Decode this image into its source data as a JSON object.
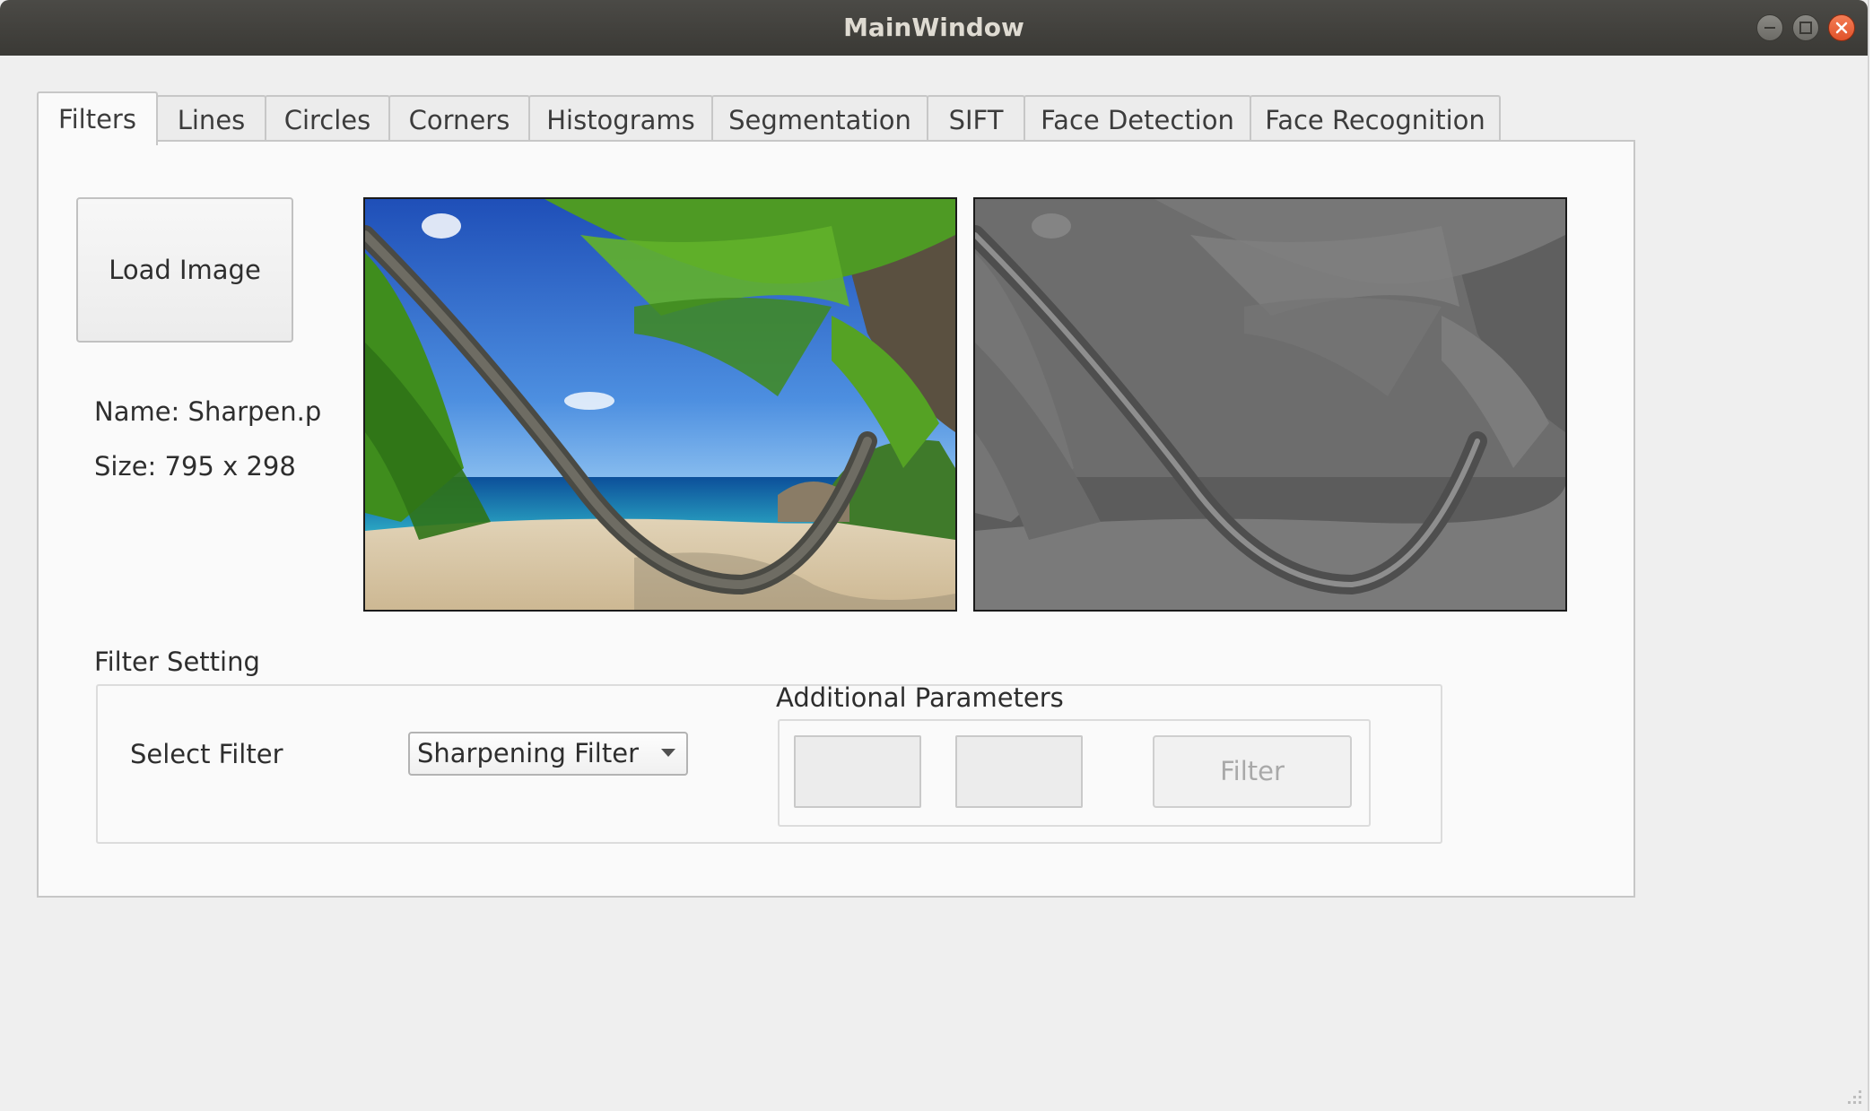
{
  "window": {
    "title": "MainWindow"
  },
  "tabs": [
    {
      "label": "Filters",
      "active": true
    },
    {
      "label": "Lines",
      "active": false
    },
    {
      "label": "Circles",
      "active": false
    },
    {
      "label": "Corners",
      "active": false
    },
    {
      "label": "Histograms",
      "active": false
    },
    {
      "label": "Segmentation",
      "active": false
    },
    {
      "label": "SIFT",
      "active": false
    },
    {
      "label": "Face Detection",
      "active": false
    },
    {
      "label": "Face Recognition",
      "active": false
    }
  ],
  "filters_tab": {
    "load_button_label": "Load Image",
    "image_name": "Name:  Sharpen.p",
    "image_size": "Size: 795 x 298",
    "filter_setting_title": "Filter Setting",
    "select_filter_label": "Select Filter",
    "selected_filter": "Sharpening Filter",
    "additional_parameters_title": "Additional Parameters",
    "param1_value": "",
    "param2_value": "",
    "filter_button_label": "Filter",
    "filter_button_enabled": false
  },
  "colors": {
    "titlebar": "#3d3c38",
    "window_bg": "#efefef",
    "panel_bg": "#fafafa",
    "close_button": "#e9592f",
    "disabled_text": "#a9a9a9"
  },
  "icons": [
    "minimize-icon",
    "maximize-icon",
    "close-icon",
    "dropdown-arrow-icon",
    "resize-grip-icon"
  ]
}
